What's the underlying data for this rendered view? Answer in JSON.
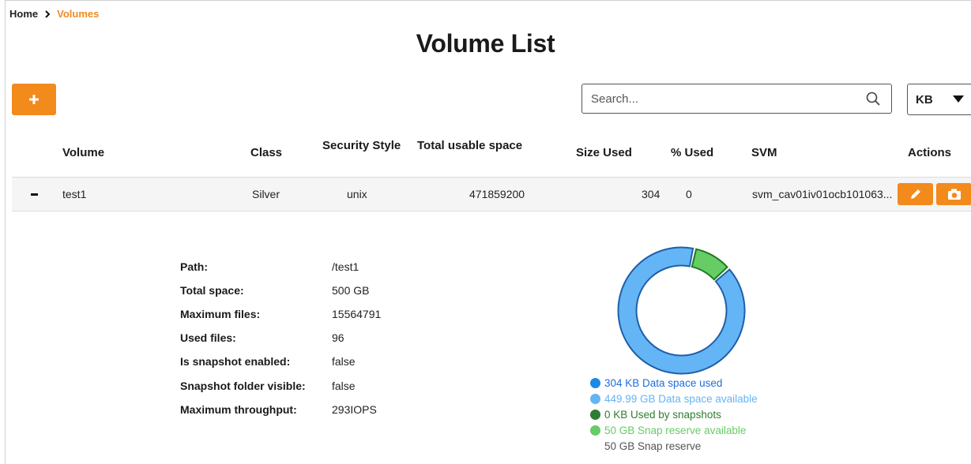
{
  "breadcrumb": {
    "home": "Home",
    "current": "Volumes"
  },
  "page_title": "Volume List",
  "search": {
    "placeholder": "Search...",
    "value": ""
  },
  "unit_selector": {
    "selected": "KB"
  },
  "colors": {
    "accent": "#f28a1c",
    "data_used": "#1e88e5",
    "data_available": "#64b5f6",
    "snap_used": "#2e7d32",
    "snap_reserve_available": "#66cc66"
  },
  "table": {
    "headers": {
      "volume": "Volume",
      "class": "Class",
      "security_style": "Security Style",
      "total_usable_space": "Total usable space",
      "size_used": "Size Used",
      "pct_used": "% Used",
      "svm": "SVM",
      "actions": "Actions"
    },
    "rows": [
      {
        "volume": "test1",
        "class": "Silver",
        "security_style": "unix",
        "total_usable_space": "471859200",
        "size_used": "304",
        "pct_used": "0",
        "svm": "svm_cav01iv01ocb101063...",
        "actions": [
          "edit-icon",
          "camera-icon"
        ]
      }
    ]
  },
  "details": {
    "path_label": "Path:",
    "path_value": "/test1",
    "total_space_label": "Total space:",
    "total_space_value": "500 GB",
    "max_files_label": "Maximum files:",
    "max_files_value": "15564791",
    "used_files_label": "Used files:",
    "used_files_value": "96",
    "snapshot_enabled_label": "Is snapshot enabled:",
    "snapshot_enabled_value": "false",
    "snapshot_folder_label": "Snapshot folder visible:",
    "snapshot_folder_value": "false",
    "max_throughput_label": "Maximum throughput:",
    "max_throughput_value": "293IOPS"
  },
  "chart_data": {
    "type": "pie",
    "slices": [
      {
        "label": "Data space available",
        "value": 449.99,
        "unit": "GB"
      },
      {
        "label": "Snap reserve available",
        "value": 50,
        "unit": "GB"
      }
    ]
  },
  "legend": {
    "data_used": "304 KB Data space used",
    "data_available": "449.99 GB Data space available",
    "snap_used": "0 KB Used by snapshots",
    "snap_reserve_available": "50 GB Snap reserve available",
    "snap_reserve": "50 GB Snap reserve"
  }
}
